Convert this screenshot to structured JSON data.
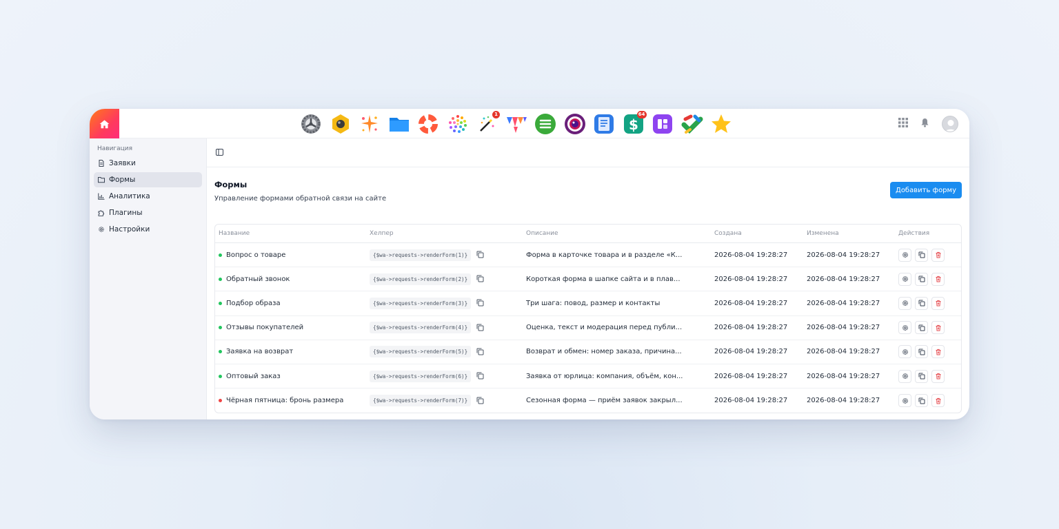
{
  "sidebar": {
    "title": "Навигация",
    "items": [
      {
        "label": "Заявки"
      },
      {
        "label": "Формы"
      },
      {
        "label": "Аналитика"
      },
      {
        "label": "Плагины"
      },
      {
        "label": "Настройки"
      }
    ]
  },
  "dock": {
    "apps": [
      {
        "icon": "gear-app-icon"
      },
      {
        "icon": "hexagon-camera-app-icon"
      },
      {
        "icon": "sparkle-app-icon"
      },
      {
        "icon": "folder-app-icon"
      },
      {
        "icon": "lifebuoy-app-icon"
      },
      {
        "icon": "dots-circle-app-icon"
      },
      {
        "icon": "magic-wand-app-icon",
        "badge": "1"
      },
      {
        "icon": "triangle-pennants-app-icon"
      },
      {
        "icon": "menu-circle-app-icon"
      },
      {
        "icon": "camera-lens-app-icon"
      },
      {
        "icon": "document-app-icon"
      },
      {
        "icon": "dollar-app-icon",
        "badge": "64"
      },
      {
        "icon": "tablet-app-icon"
      },
      {
        "icon": "colorful-check-app-icon"
      },
      {
        "icon": "star-app-icon"
      }
    ]
  },
  "page": {
    "title": "Формы",
    "subtitle": "Управление формами обратной связи на сайте",
    "add_button": "Добавить форму"
  },
  "table": {
    "columns": [
      "Название",
      "Хелпер",
      "Описание",
      "Создана",
      "Изменена",
      "Действия"
    ],
    "rows": [
      {
        "status": "active",
        "name": "Вопрос о товаре",
        "helper": "{$wa->requests->renderForm(1)}",
        "description": "Форма в карточке товара и в разделе «К...",
        "created": "2026-08-04 19:28:27",
        "updated": "2026-08-04 19:28:27"
      },
      {
        "status": "active",
        "name": "Обратный звонок",
        "helper": "{$wa->requests->renderForm(2)}",
        "description": "Короткая форма в шапке сайта и в плав...",
        "created": "2026-08-04 19:28:27",
        "updated": "2026-08-04 19:28:27"
      },
      {
        "status": "active",
        "name": "Подбор образа",
        "helper": "{$wa->requests->renderForm(3)}",
        "description": "Три шага: повод, размер и контакты",
        "created": "2026-08-04 19:28:27",
        "updated": "2026-08-04 19:28:27"
      },
      {
        "status": "active",
        "name": "Отзывы покупателей",
        "helper": "{$wa->requests->renderForm(4)}",
        "description": "Оценка, текст и модерация перед публи...",
        "created": "2026-08-04 19:28:27",
        "updated": "2026-08-04 19:28:27"
      },
      {
        "status": "active",
        "name": "Заявка на возврат",
        "helper": "{$wa->requests->renderForm(5)}",
        "description": "Возврат и обмен: номер заказа, причина...",
        "created": "2026-08-04 19:28:27",
        "updated": "2026-08-04 19:28:27"
      },
      {
        "status": "active",
        "name": "Оптовый заказ",
        "helper": "{$wa->requests->renderForm(6)}",
        "description": "Заявка от юрлица: компания, объём, кон...",
        "created": "2026-08-04 19:28:27",
        "updated": "2026-08-04 19:28:27"
      },
      {
        "status": "inactive",
        "name": "Чёрная пятница: бронь размера",
        "helper": "{$wa->requests->renderForm(7)}",
        "description": "Сезонная форма — приём заявок закрыл...",
        "created": "2026-08-04 19:28:27",
        "updated": "2026-08-04 19:28:27"
      }
    ]
  },
  "colors": {
    "accent": "#1a8cf0",
    "active_dot": "#22c55e",
    "inactive_dot": "#ef4444",
    "delete": "#e5484d"
  }
}
